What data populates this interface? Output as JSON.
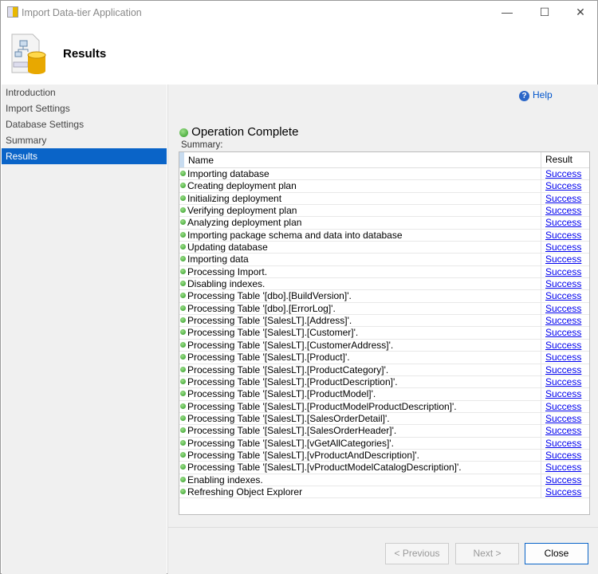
{
  "window": {
    "title": "Import Data-tier Application",
    "minimize": "—",
    "maximize": "☐",
    "close": "✕"
  },
  "header": {
    "title": "Results"
  },
  "sidebar": {
    "items": [
      {
        "label": "Introduction"
      },
      {
        "label": "Import Settings"
      },
      {
        "label": "Database Settings"
      },
      {
        "label": "Summary"
      },
      {
        "label": "Results",
        "selected": true
      }
    ]
  },
  "main": {
    "help": "Help",
    "status": "Operation Complete",
    "summary_label": "Summary:",
    "columns": {
      "name": "Name",
      "result": "Result"
    },
    "rows": [
      {
        "name": "Importing database",
        "result": "Success"
      },
      {
        "name": "Creating deployment plan",
        "result": "Success"
      },
      {
        "name": "Initializing deployment",
        "result": "Success"
      },
      {
        "name": "Verifying deployment plan",
        "result": "Success"
      },
      {
        "name": "Analyzing deployment plan",
        "result": "Success"
      },
      {
        "name": "Importing package schema and data into database",
        "result": "Success"
      },
      {
        "name": "Updating database",
        "result": "Success"
      },
      {
        "name": "Importing data",
        "result": "Success"
      },
      {
        "name": "Processing Import.",
        "result": "Success"
      },
      {
        "name": "Disabling indexes.",
        "result": "Success"
      },
      {
        "name": "Processing Table '[dbo].[BuildVersion]'.",
        "result": "Success"
      },
      {
        "name": "Processing Table '[dbo].[ErrorLog]'.",
        "result": "Success"
      },
      {
        "name": "Processing Table '[SalesLT].[Address]'.",
        "result": "Success"
      },
      {
        "name": "Processing Table '[SalesLT].[Customer]'.",
        "result": "Success"
      },
      {
        "name": "Processing Table '[SalesLT].[CustomerAddress]'.",
        "result": "Success"
      },
      {
        "name": "Processing Table '[SalesLT].[Product]'.",
        "result": "Success"
      },
      {
        "name": "Processing Table '[SalesLT].[ProductCategory]'.",
        "result": "Success"
      },
      {
        "name": "Processing Table '[SalesLT].[ProductDescription]'.",
        "result": "Success"
      },
      {
        "name": "Processing Table '[SalesLT].[ProductModel]'.",
        "result": "Success"
      },
      {
        "name": "Processing Table '[SalesLT].[ProductModelProductDescription]'.",
        "result": "Success"
      },
      {
        "name": "Processing Table '[SalesLT].[SalesOrderDetail]'.",
        "result": "Success"
      },
      {
        "name": "Processing Table '[SalesLT].[SalesOrderHeader]'.",
        "result": "Success"
      },
      {
        "name": "Processing Table '[SalesLT].[vGetAllCategories]'.",
        "result": "Success"
      },
      {
        "name": "Processing Table '[SalesLT].[vProductAndDescription]'.",
        "result": "Success"
      },
      {
        "name": "Processing Table '[SalesLT].[vProductModelCatalogDescription]'.",
        "result": "Success"
      },
      {
        "name": "Enabling indexes.",
        "result": "Success"
      },
      {
        "name": "Refreshing Object Explorer",
        "result": "Success"
      }
    ]
  },
  "footer": {
    "previous": "< Previous",
    "next": "Next >",
    "close": "Close"
  }
}
